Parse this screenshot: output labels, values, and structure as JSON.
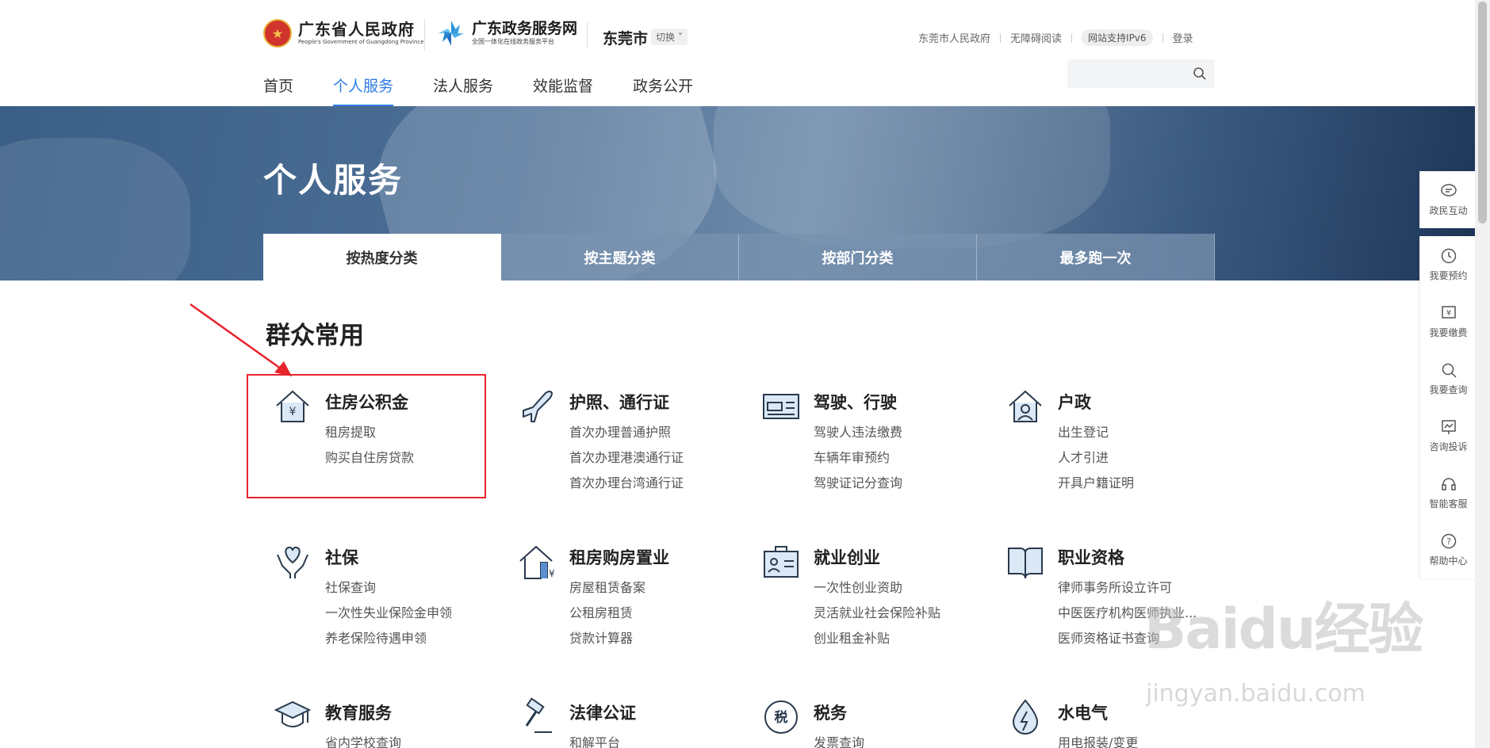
{
  "header": {
    "gov_logo_cn": "广东省人民政府",
    "gov_logo_en": "People's Government of Guangdong Province",
    "portal_name": "广东政务服务网",
    "portal_sub": "全国一体化在线政务服务平台",
    "city": "东莞市",
    "switch_label": "切换",
    "links": {
      "city_gov": "东莞市人民政府",
      "accessible": "无障碍阅读",
      "ipv6": "网站支持IPv6",
      "login": "登录"
    },
    "nav": [
      "首页",
      "个人服务",
      "法人服务",
      "效能监督",
      "政务公开"
    ],
    "search_placeholder": ""
  },
  "banner": {
    "title": "个人服务",
    "tabs": [
      "按热度分类",
      "按主题分类",
      "按部门分类",
      "最多跑一次"
    ]
  },
  "section": {
    "title": "群众常用"
  },
  "cards": [
    {
      "title": "住房公积金",
      "icon": "house-yuan-icon",
      "links": [
        "租房提取",
        "购买自住房贷款"
      ]
    },
    {
      "title": "护照、通行证",
      "icon": "airplane-icon",
      "links": [
        "首次办理普通护照",
        "首次办理港澳通行证",
        "首次办理台湾通行证"
      ]
    },
    {
      "title": "驾驶、行驶",
      "icon": "car-license-icon",
      "links": [
        "驾驶人违法缴费",
        "车辆年审预约",
        "驾驶证记分查询"
      ]
    },
    {
      "title": "户政",
      "icon": "house-person-icon",
      "links": [
        "出生登记",
        "人才引进",
        "开具户籍证明"
      ]
    },
    {
      "title": "社保",
      "icon": "heart-hands-icon",
      "links": [
        "社保查询",
        "一次性失业保险金申领",
        "养老保险待遇申领"
      ]
    },
    {
      "title": "租房购房置业",
      "icon": "house-rent-icon",
      "links": [
        "房屋租赁备案",
        "公租房租赁",
        "贷款计算器"
      ]
    },
    {
      "title": "就业创业",
      "icon": "briefcase-id-icon",
      "links": [
        "一次性创业资助",
        "灵活就业社会保险补贴",
        "创业租金补贴"
      ]
    },
    {
      "title": "职业资格",
      "icon": "open-book-icon",
      "links": [
        "律师事务所设立许可",
        "中医医疗机构医师执业...",
        "医师资格证书查询"
      ]
    },
    {
      "title": "教育服务",
      "icon": "graduation-cap-icon",
      "links": [
        "省内学校查询"
      ]
    },
    {
      "title": "法律公证",
      "icon": "gavel-icon",
      "links": [
        "和解平台"
      ]
    },
    {
      "title": "税务",
      "icon": "tax-stamp-icon",
      "links": [
        "发票查询"
      ]
    },
    {
      "title": "水电气",
      "icon": "water-drop-icon",
      "links": [
        "用电报装/变更"
      ]
    }
  ],
  "rail": [
    "政民互动",
    "我要预约",
    "我要缴费",
    "我要查询",
    "咨询投诉",
    "智能客服",
    "帮助中心"
  ],
  "watermark": {
    "main": "Baidu经验",
    "sub": "jingyan.baidu.com"
  },
  "colors": {
    "accent": "#2d7be6",
    "highlight": "#e8242d",
    "banner": "#3a5e86"
  }
}
